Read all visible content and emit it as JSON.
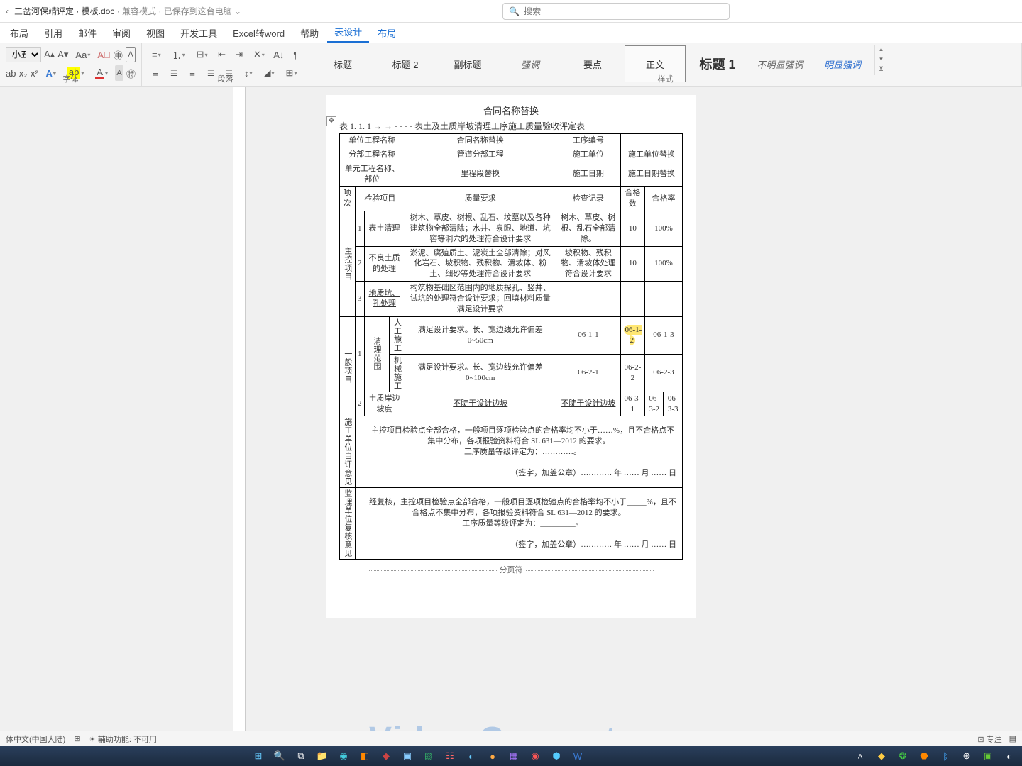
{
  "title": {
    "doc": "三岔河保靖评定 · 模板.doc",
    "mode": " · 兼容模式 · 已保存到这台电脑"
  },
  "search": {
    "placeholder": "搜索"
  },
  "tabs": [
    "布局",
    "引用",
    "邮件",
    "审阅",
    "视图",
    "开发工具",
    "Excel转word",
    "帮助",
    "表设计",
    "布局"
  ],
  "ribbon": {
    "fontSize": "小五",
    "groups": {
      "font": "字体",
      "para": "段落",
      "style": "样式"
    }
  },
  "styles": [
    {
      "name": "标题",
      "cls": ""
    },
    {
      "name": "标题 2",
      "cls": ""
    },
    {
      "name": "副标题",
      "cls": ""
    },
    {
      "name": "强调",
      "cls": "sname-em"
    },
    {
      "name": "要点",
      "cls": ""
    },
    {
      "name": "正文",
      "cls": "",
      "sel": true
    },
    {
      "name": "标题 1",
      "cls": "sname-big"
    },
    {
      "name": "不明显强调",
      "cls": "sname-em"
    },
    {
      "name": "明显强调",
      "cls": "sname-blue"
    }
  ],
  "doc": {
    "contractTitle": "合同名称替换",
    "tableCaption": "表 1. 1. 1 →   →  · · · ·  表土及土质岸坡清理工序施工质量验收评定表",
    "r1": {
      "c1": "单位工程名称",
      "c2": "合同名称替换",
      "c3": "工序编号",
      "c4": ""
    },
    "r2": {
      "c1": "分部工程名称",
      "c2": "管道分部工程",
      "c3": "施工单位",
      "c4": "施工单位替换"
    },
    "r3": {
      "c1": "单元工程名称、部位",
      "c2": "里程段替换",
      "c3": "施工日期",
      "c4": "施工日期替换"
    },
    "hdr": {
      "c1": "项次",
      "c2": "检验项目",
      "c3": "质量要求",
      "c4": "检查记录",
      "c5": "合格数",
      "c6": "合格率"
    },
    "grpA": "主控项目",
    "a1": {
      "no": "1",
      "item": "表土清理",
      "req": "树木、草皮、树根、乱石、坟墓以及各种建筑物全部清除；水井、泉眼、地道、坑窖等洞穴的处理符合设计要求",
      "rec": "树木、草皮、树根、乱石全部清除。",
      "qn": "10",
      "qr": "100%"
    },
    "a2": {
      "no": "2",
      "item": "不良土质的处理",
      "req": "淤泥、腐殖质土、泥炭土全部清除；对风化岩石、坡积物、残积物、滑坡体、粉土、细砂等处理符合设计要求",
      "rec": "坡积物、残积物、滑坡体处理符合设计要求",
      "qn": "10",
      "qr": "100%"
    },
    "a3": {
      "no": "3",
      "item": "地质坑、孔处理",
      "req": "构筑物基础区范围内的地质探孔、竖井、试坑的处理符合设计要求；回填材料质量满足设计要求",
      "rec": "",
      "qn": "",
      "qr": ""
    },
    "grpB": "一般项目",
    "b1": {
      "no": "1",
      "item": "清理范围",
      "sub1": "人工施工",
      "req1": "满足设计要求。长、宽边线允许偏差 0~50cm",
      "rec1": "06-1-1",
      "q1a": "06-1-2",
      "q1b": "06-1-3",
      "sub2": "机械施工",
      "req2": "满足设计要求。长、宽边线允许偏差 0~100cm",
      "rec2": "06-2-1",
      "q2a": "06-2-2",
      "q2b": "06-2-3"
    },
    "b2": {
      "no": "2",
      "item": "土质岸边坡度",
      "req": "不陡于设计边坡",
      "rec": "不陡于设计边坡",
      "qa": "06-3-1",
      "qb": "06-3-2",
      "qc": "06-3-3"
    },
    "eval1Label": "施工单位自评意见",
    "eval1": "主控项目检验点全部合格，一般项目逐项检验点的合格率均不小于……%，且不合格点不集中分布，各项报验资料符合 SL 631—2012 的要求。",
    "eval1b": "工序质量等级评定为：…………。",
    "sign": "（签字，加盖公章）………… 年 …… 月 …… 日",
    "eval2Label": "监理单位复核意见",
    "eval2": "经复核，主控项目检验点全部合格，一般项目逐项检验点的合格率均不小于_____%，且不合格点不集中分布，各项报验资料符合 SL 631—2012 的要求。",
    "eval2b": "工序质量等级评定为：_________。",
    "pagebreak": "分页符"
  },
  "status": {
    "lang": "体中文(中国大陆)",
    "acc": "辅助功能: 不可用",
    "focus": "专注"
  },
  "watermark": "Video Converter"
}
